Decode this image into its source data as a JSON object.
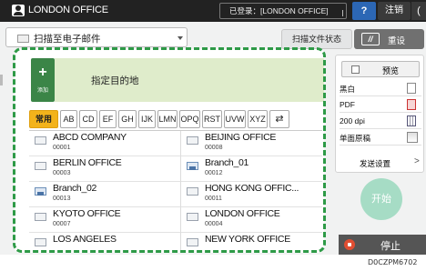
{
  "topbar": {
    "office_title": "LONDON OFFICE",
    "login_status": "已登录：[LONDON OFFICE]",
    "help_label": "?",
    "logout_label": "注销",
    "power_label": "("
  },
  "mode_select": {
    "label": "扫描至电子邮件"
  },
  "toolbar": {
    "scan_status_label": "扫描文件状态",
    "reset_label": "重设",
    "reset_icon_label": "//"
  },
  "destination": {
    "add_label": "添加",
    "plus": "+",
    "field_label": "指定目的地"
  },
  "index_tabs": [
    "常用",
    "AB",
    "CD",
    "EF",
    "GH",
    "IJK",
    "LMN",
    "OPQ",
    "RST",
    "UVW",
    "XYZ",
    "⇄"
  ],
  "entries": [
    {
      "name": "ABCD COMPANY",
      "number": "00001",
      "type": "single"
    },
    {
      "name": "BEIJING OFFICE",
      "number": "00008",
      "type": "single"
    },
    {
      "name": "BERLIN OFFICE",
      "number": "00003",
      "type": "single"
    },
    {
      "name": "Branch_01",
      "number": "00012",
      "type": "group"
    },
    {
      "name": "Branch_02",
      "number": "00013",
      "type": "group"
    },
    {
      "name": "HONG KONG OFFIC...",
      "number": "00011",
      "type": "single"
    },
    {
      "name": "KYOTO OFFICE",
      "number": "00007",
      "type": "single"
    },
    {
      "name": "LONDON OFFICE",
      "number": "00004",
      "type": "single"
    },
    {
      "name": "LOS ANGELES",
      "number": "",
      "type": "single"
    },
    {
      "name": "NEW YORK OFFICE",
      "number": "",
      "type": "single"
    }
  ],
  "settings": {
    "preview_label": "预览",
    "items": [
      "黑白",
      "PDF",
      "200 dpi",
      "单面原稿"
    ],
    "send_settings_label": "发送设置",
    "chevron": ">"
  },
  "start_label": "开始",
  "stop_label": "停止",
  "reference_code": "D0CZPM6702"
}
